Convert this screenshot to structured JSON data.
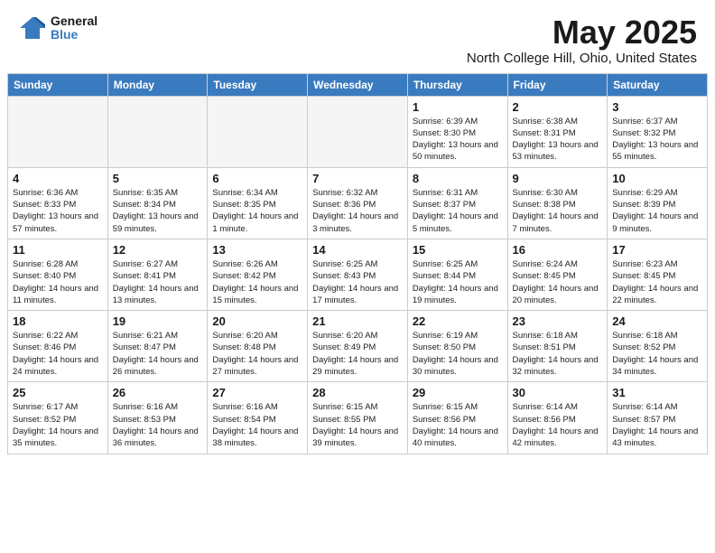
{
  "header": {
    "logo_line1": "General",
    "logo_line2": "Blue",
    "title": "May 2025",
    "subtitle": "North College Hill, Ohio, United States"
  },
  "calendar": {
    "days_of_week": [
      "Sunday",
      "Monday",
      "Tuesday",
      "Wednesday",
      "Thursday",
      "Friday",
      "Saturday"
    ],
    "weeks": [
      [
        {
          "day": "",
          "empty": true
        },
        {
          "day": "",
          "empty": true
        },
        {
          "day": "",
          "empty": true
        },
        {
          "day": "",
          "empty": true
        },
        {
          "day": "1",
          "sunrise": "6:39 AM",
          "sunset": "8:30 PM",
          "daylight": "13 hours and 50 minutes."
        },
        {
          "day": "2",
          "sunrise": "6:38 AM",
          "sunset": "8:31 PM",
          "daylight": "13 hours and 53 minutes."
        },
        {
          "day": "3",
          "sunrise": "6:37 AM",
          "sunset": "8:32 PM",
          "daylight": "13 hours and 55 minutes."
        }
      ],
      [
        {
          "day": "4",
          "sunrise": "6:36 AM",
          "sunset": "8:33 PM",
          "daylight": "13 hours and 57 minutes."
        },
        {
          "day": "5",
          "sunrise": "6:35 AM",
          "sunset": "8:34 PM",
          "daylight": "13 hours and 59 minutes."
        },
        {
          "day": "6",
          "sunrise": "6:34 AM",
          "sunset": "8:35 PM",
          "daylight": "14 hours and 1 minute."
        },
        {
          "day": "7",
          "sunrise": "6:32 AM",
          "sunset": "8:36 PM",
          "daylight": "14 hours and 3 minutes."
        },
        {
          "day": "8",
          "sunrise": "6:31 AM",
          "sunset": "8:37 PM",
          "daylight": "14 hours and 5 minutes."
        },
        {
          "day": "9",
          "sunrise": "6:30 AM",
          "sunset": "8:38 PM",
          "daylight": "14 hours and 7 minutes."
        },
        {
          "day": "10",
          "sunrise": "6:29 AM",
          "sunset": "8:39 PM",
          "daylight": "14 hours and 9 minutes."
        }
      ],
      [
        {
          "day": "11",
          "sunrise": "6:28 AM",
          "sunset": "8:40 PM",
          "daylight": "14 hours and 11 minutes."
        },
        {
          "day": "12",
          "sunrise": "6:27 AM",
          "sunset": "8:41 PM",
          "daylight": "14 hours and 13 minutes."
        },
        {
          "day": "13",
          "sunrise": "6:26 AM",
          "sunset": "8:42 PM",
          "daylight": "14 hours and 15 minutes."
        },
        {
          "day": "14",
          "sunrise": "6:25 AM",
          "sunset": "8:43 PM",
          "daylight": "14 hours and 17 minutes."
        },
        {
          "day": "15",
          "sunrise": "6:25 AM",
          "sunset": "8:44 PM",
          "daylight": "14 hours and 19 minutes."
        },
        {
          "day": "16",
          "sunrise": "6:24 AM",
          "sunset": "8:45 PM",
          "daylight": "14 hours and 20 minutes."
        },
        {
          "day": "17",
          "sunrise": "6:23 AM",
          "sunset": "8:45 PM",
          "daylight": "14 hours and 22 minutes."
        }
      ],
      [
        {
          "day": "18",
          "sunrise": "6:22 AM",
          "sunset": "8:46 PM",
          "daylight": "14 hours and 24 minutes."
        },
        {
          "day": "19",
          "sunrise": "6:21 AM",
          "sunset": "8:47 PM",
          "daylight": "14 hours and 26 minutes."
        },
        {
          "day": "20",
          "sunrise": "6:20 AM",
          "sunset": "8:48 PM",
          "daylight": "14 hours and 27 minutes."
        },
        {
          "day": "21",
          "sunrise": "6:20 AM",
          "sunset": "8:49 PM",
          "daylight": "14 hours and 29 minutes."
        },
        {
          "day": "22",
          "sunrise": "6:19 AM",
          "sunset": "8:50 PM",
          "daylight": "14 hours and 30 minutes."
        },
        {
          "day": "23",
          "sunrise": "6:18 AM",
          "sunset": "8:51 PM",
          "daylight": "14 hours and 32 minutes."
        },
        {
          "day": "24",
          "sunrise": "6:18 AM",
          "sunset": "8:52 PM",
          "daylight": "14 hours and 34 minutes."
        }
      ],
      [
        {
          "day": "25",
          "sunrise": "6:17 AM",
          "sunset": "8:52 PM",
          "daylight": "14 hours and 35 minutes."
        },
        {
          "day": "26",
          "sunrise": "6:16 AM",
          "sunset": "8:53 PM",
          "daylight": "14 hours and 36 minutes."
        },
        {
          "day": "27",
          "sunrise": "6:16 AM",
          "sunset": "8:54 PM",
          "daylight": "14 hours and 38 minutes."
        },
        {
          "day": "28",
          "sunrise": "6:15 AM",
          "sunset": "8:55 PM",
          "daylight": "14 hours and 39 minutes."
        },
        {
          "day": "29",
          "sunrise": "6:15 AM",
          "sunset": "8:56 PM",
          "daylight": "14 hours and 40 minutes."
        },
        {
          "day": "30",
          "sunrise": "6:14 AM",
          "sunset": "8:56 PM",
          "daylight": "14 hours and 42 minutes."
        },
        {
          "day": "31",
          "sunrise": "6:14 AM",
          "sunset": "8:57 PM",
          "daylight": "14 hours and 43 minutes."
        }
      ]
    ]
  }
}
